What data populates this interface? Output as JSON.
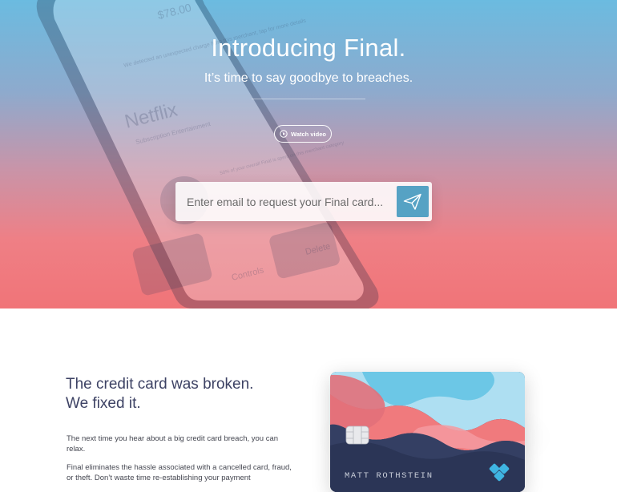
{
  "hero": {
    "title": "Introducing Final.",
    "subtitle": "It’s time to say goodbye to breaches.",
    "watch_label": "Watch video",
    "email_placeholder": "Enter email to request your Final card...",
    "background_phone_text": {
      "amount": "$78.00",
      "merchant": "Netflix",
      "merchant_sub": "Subscription Entertainment",
      "notice": "We detected an unexpected charge from this merchant, tap for more details",
      "reminder": "50% of your overall Final is spent on this merchant category",
      "controls_label": "Controls",
      "delete_label": "Delete"
    }
  },
  "content": {
    "title_line1": "The credit card was broken.",
    "title_line2": "We fixed it.",
    "paragraph1": "The next time you hear about a big credit card breach, you can relax.",
    "paragraph2": "Final eliminates the hassle associated with a cancelled card, fraud, or theft. Don’t waste time re-establishing your payment"
  },
  "card": {
    "holder_name": "MATT ROTHSTEIN"
  },
  "colors": {
    "hero_top": "#6bbbe0",
    "hero_bottom": "#f07478",
    "send_button": "#56a2c4",
    "title_text": "#3d4264",
    "card_navy": "#2b3556",
    "card_coral": "#f07a7d",
    "card_sky": "#6cc7e6"
  }
}
